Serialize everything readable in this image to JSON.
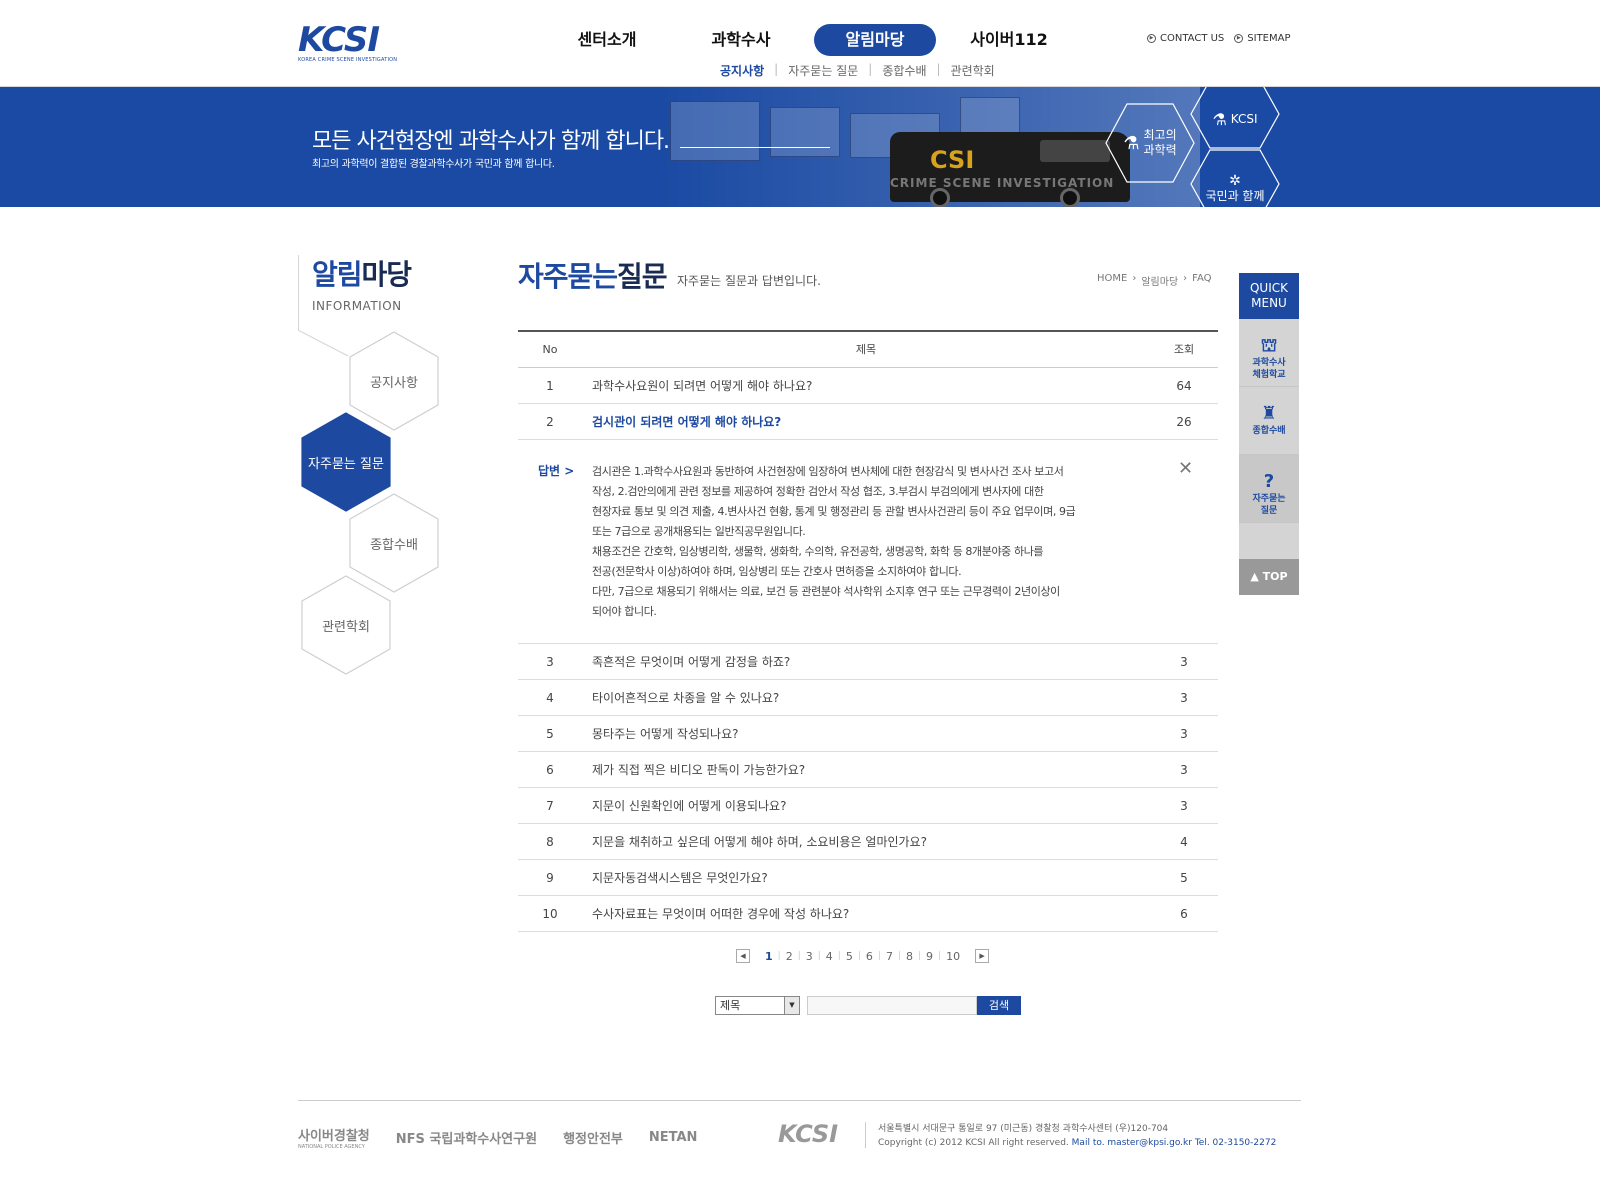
{
  "header": {
    "logo_text": "KCSI",
    "logo_sub": "KOREA CRIME SCENE INVESTIGATION",
    "gnb": [
      "센터소개",
      "과학수사",
      "알림마당",
      "사이버112"
    ],
    "sub_gnb": [
      "공지사항",
      "자주묻는 질문",
      "종합수배",
      "관련학회"
    ],
    "util": [
      "CONTACT US",
      "SITEMAP"
    ]
  },
  "banner": {
    "headline": "모든 사건현장엔 과학수사가 함께 합니다.",
    "subline": "최고의 과학력이 결합된 경찰과학수사가 국민과 함께 합니다.",
    "van_csi": "CSI",
    "van_text": "CRIME SCENE INVESTIGATION",
    "hex1": "최고의\n과학력",
    "hex2": "KCSI",
    "hex3": "국민과 함께"
  },
  "lnb": {
    "title_blue": "알림",
    "title_dark": "마당",
    "en": "INFORMATION",
    "items": [
      "공지사항",
      "자주묻는 질문",
      "종합수배",
      "관련학회"
    ]
  },
  "content": {
    "title_blue": "자주묻는",
    "title_dark": "질문",
    "desc": "자주묻는 질문과 답변입니다.",
    "breadcrumb": [
      "HOME",
      "알림마당",
      "FAQ"
    ],
    "columns": [
      "No",
      "제목",
      "조회"
    ],
    "rows": [
      {
        "no": "1",
        "title": "과학수사요원이 되려면 어떻게 해야 하나요?",
        "hits": "64"
      },
      {
        "no": "2",
        "title": "검시관이 되려면 어떻게 해야 하나요?",
        "hits": "26"
      },
      {
        "no": "3",
        "title": "족흔적은 무엇이며 어떻게 감정을 하죠?",
        "hits": "3"
      },
      {
        "no": "4",
        "title": "타이어흔적으로 차종을 알 수 있나요?",
        "hits": "3"
      },
      {
        "no": "5",
        "title": "몽타주는 어떻게 작성되나요?",
        "hits": "3"
      },
      {
        "no": "6",
        "title": "제가 직접 찍은 비디오 판독이 가능한가요?",
        "hits": "3"
      },
      {
        "no": "7",
        "title": "지문이 신원확인에 어떻게 이용되나요?",
        "hits": "3"
      },
      {
        "no": "8",
        "title": "지문을 채취하고 싶은데 어떻게 해야 하며, 소요비용은 얼마인가요?",
        "hits": "4"
      },
      {
        "no": "9",
        "title": "지문자동검색시스템은 무엇인가요?",
        "hits": "5"
      },
      {
        "no": "10",
        "title": "수사자료표는 무엇이며 어떠한 경우에 작성 하나요?",
        "hits": "6"
      }
    ],
    "answer_tag": "답변 >",
    "answer_lines": [
      "검시관은 1.과학수사요원과 동반하여 사건현장에 임장하여 변사체에 대한 현장감식 및 변사사건 조사 보고서",
      "작성,  2.검안의에게 관련 정보를 제공하여 정확한 검안서 작성 협조, 3.부검시 부검의에게 변사자에 대한",
      "현장자료 통보 및 의견 제출, 4.변사사건 현황, 통계 및 행정관리 등 관할 변사사건관리 등이 주요 업무이며, 9급",
      "또는 7급으로 공개채용되는 일반직공무원입니다.",
      "채용조건은 간호학, 임상병리학, 생물학, 생화학, 수의학, 유전공학, 생명공학, 화학 등 8개분야중 하나를",
      "전공(전문학사 이상)하여야 하며, 임상병리 또는 간호사 면허증을 소지하여야 합니다.",
      "다만, 7급으로 채용되기 위해서는 의료, 보건 등 관련분야 석사학위 소지후 연구 또는 근무경력이 2년이상이",
      "되어야 합니다."
    ],
    "pages": [
      "1",
      "2",
      "3",
      "4",
      "5",
      "6",
      "7",
      "8",
      "9",
      "10"
    ],
    "search_select": "제목",
    "search_button": "검색"
  },
  "quick": {
    "head": "QUICK MENU",
    "items": [
      "과학수사\n체험학교",
      "종합수배",
      "자주묻는\n질문"
    ],
    "top": "▲ TOP"
  },
  "footer": {
    "logos": [
      "사이버경찰청",
      "NFS 국립과학수사연구원",
      "행정안전부",
      "NETAN"
    ],
    "logo_sub": "NATIONAL POLICE AGENCY",
    "kcsi": "KCSI",
    "address": "서울특별시 서대문구 통일로 97 (미근동) 경찰청 과학수사센터 (우)120-704",
    "copyright": "Copyright (c) 2012 KCSI All right reserved.",
    "mail": "Mail to. master@kpsi.go.kr Tel. 02-3150-2272"
  },
  "colors": {
    "brand": "#1d4aa0",
    "banner": "#1a4aa3",
    "quick_gray": "#d4d4d4"
  }
}
